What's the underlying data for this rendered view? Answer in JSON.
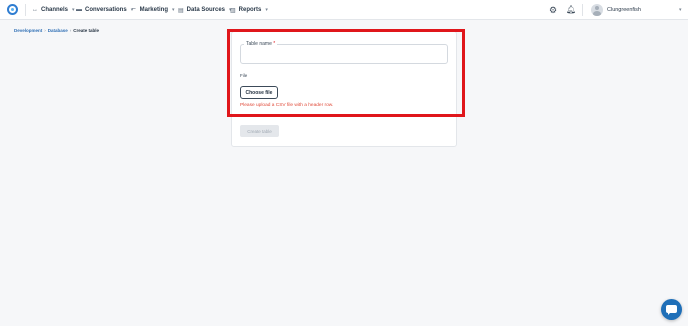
{
  "topbar": {
    "nav": [
      {
        "label": "Channels",
        "icon": "channels-icon"
      },
      {
        "label": "Conversations",
        "icon": "chat-icon"
      },
      {
        "label": "Marketing",
        "icon": "broadcast-icon"
      },
      {
        "label": "Data Sources",
        "icon": "database-icon"
      },
      {
        "label": "Reports",
        "icon": "bar-chart-icon"
      }
    ],
    "user_name": "Clungreenfish"
  },
  "breadcrumb": {
    "items": [
      "Development",
      "Database"
    ],
    "separator": "›",
    "current": "Create table"
  },
  "form": {
    "table_name_label": "Table name",
    "required_marker": "*",
    "table_name_value": "",
    "file_label": "File",
    "choose_file_label": "Choose file",
    "error_message": "Please upload a CSV file with a header row.",
    "create_button_label": "Create table"
  },
  "colors": {
    "accent": "#2f6fb5",
    "error": "#e04b3a",
    "highlight": "#e0161b",
    "chat": "#1f6fb8"
  }
}
